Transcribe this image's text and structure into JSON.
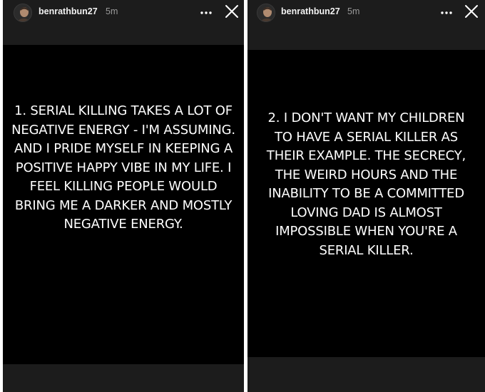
{
  "stories": [
    {
      "username": "benrathbun27",
      "time": "5m",
      "text": "1. SERIAL KILLING TAKES A LOT OF NEGATIVE ENERGY - I'M ASSUMING. AND I PRIDE MYSELF IN KEEPING A POSITIVE HAPPY VIBE IN MY LIFE. I FEEL KILLING PEOPLE WOULD BRING ME A DARKER AND MOSTLY NEGATIVE ENERGY.",
      "more_icon": "more-horizontal-icon",
      "close_icon": "close-icon"
    },
    {
      "username": "benrathbun27",
      "time": "5m",
      "text": "2. I DON'T WANT MY CHILDREN TO HAVE A SERIAL KILLER AS THEIR EXAMPLE. THE SECRECY, THE WEIRD HOURS AND THE INABILITY TO BE A COMMITTED LOVING DAD IS ALMOST IMPOSSIBLE WHEN YOU'RE A SERIAL KILLER.",
      "more_icon": "more-horizontal-icon",
      "close_icon": "close-icon"
    }
  ],
  "colors": {
    "panel_bg": "#1c1c1c",
    "story_bg": "#000000",
    "text": "#ffffff",
    "timestamp": "#9a9a9a"
  }
}
